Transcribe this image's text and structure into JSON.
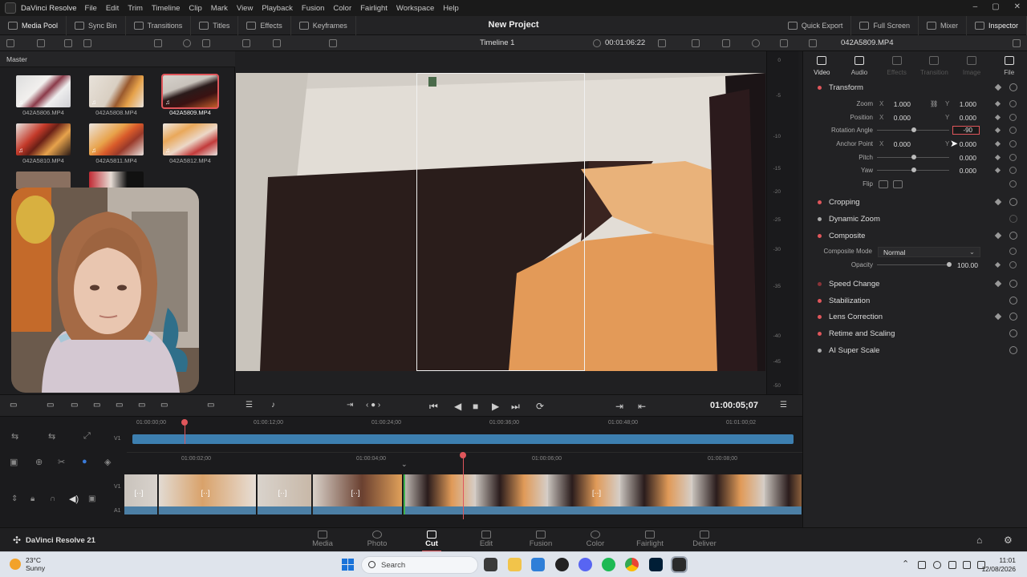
{
  "menubar": {
    "app_name": "DaVinci Resolve",
    "items": [
      "File",
      "Edit",
      "Trim",
      "Timeline",
      "Clip",
      "Mark",
      "View",
      "Playback",
      "Fusion",
      "Color",
      "Fairlight",
      "Workspace",
      "Help"
    ]
  },
  "toolbar": {
    "media_pool": "Media Pool",
    "sync_bin": "Sync Bin",
    "transitions": "Transitions",
    "titles": "Titles",
    "effects": "Effects",
    "keyframes": "Keyframes",
    "project_title": "New Project",
    "quick_export": "Quick Export",
    "full_screen": "Full Screen",
    "mixer": "Mixer",
    "inspector": "Inspector"
  },
  "subbar": {
    "timeline_name": "Timeline 1",
    "timecode": "00:01:06:22",
    "clip_name": "042A5809.MP4"
  },
  "mediapool": {
    "bin": "Master",
    "clips": [
      {
        "name": "042A5806.MP4",
        "selected": false
      },
      {
        "name": "042A5808.MP4",
        "selected": false
      },
      {
        "name": "042A5809.MP4",
        "selected": true
      },
      {
        "name": "042A5810.MP4",
        "selected": false
      },
      {
        "name": "042A5811.MP4",
        "selected": false
      },
      {
        "name": "042A5812.MP4",
        "selected": false
      }
    ]
  },
  "meter": {
    "ticks": [
      "0",
      "-5",
      "-10",
      "-15",
      "-20",
      "-25",
      "-30",
      "-35",
      "-40",
      "-45",
      "-50"
    ]
  },
  "inspector": {
    "tabs": [
      "Video",
      "Audio",
      "Effects",
      "Transition",
      "Image",
      "File"
    ],
    "transform": {
      "title": "Transform",
      "zoom_label": "Zoom",
      "zoom_x": "1.000",
      "zoom_y": "1.000",
      "position_label": "Position",
      "position_x": "0.000",
      "position_y": "0.000",
      "rotation_label": "Rotation Angle",
      "rotation_value": "-90",
      "anchor_label": "Anchor Point",
      "anchor_x": "0.000",
      "anchor_y": "0.000",
      "pitch_label": "Pitch",
      "pitch_value": "0.000",
      "yaw_label": "Yaw",
      "yaw_value": "0.000",
      "flip_label": "Flip",
      "axis_x": "X",
      "axis_y": "Y"
    },
    "cropping": "Cropping",
    "dynamic_zoom": "Dynamic Zoom",
    "composite": {
      "title": "Composite",
      "mode_label": "Composite Mode",
      "mode_value": "Normal",
      "opacity_label": "Opacity",
      "opacity_value": "100.00"
    },
    "speed_change": "Speed Change",
    "stabilization": "Stabilization",
    "lens_correction": "Lens Correction",
    "retime_scaling": "Retime and Scaling",
    "ai_super_scale": "AI Super Scale"
  },
  "transport": {
    "timecode": "01:00:05;07"
  },
  "timeline": {
    "upper_ruler": [
      "01:00:00;00",
      "01:00:12;00",
      "01:00:24;00",
      "01:00:36;00",
      "01:00:48;00",
      "01:01:00;02"
    ],
    "lower_ruler": [
      "01:00:02;00",
      "01:00:04;00",
      "01:00:06;00",
      "01:00:08;00"
    ],
    "track_v": "V1",
    "track_a": "A1"
  },
  "pagebar": {
    "brand": "DaVinci Resolve 21",
    "pages": [
      "Media",
      "Photo",
      "Cut",
      "Edit",
      "Fusion",
      "Color",
      "Fairlight",
      "Deliver"
    ],
    "active": "Cut"
  },
  "taskbar": {
    "temperature": "23°C",
    "weather": "Sunny",
    "search_placeholder": "Search",
    "time": "11:01",
    "date": "12/08/2026"
  },
  "colors": {
    "accent": "#e0565b",
    "clip_blue": "#3d7fb0"
  }
}
